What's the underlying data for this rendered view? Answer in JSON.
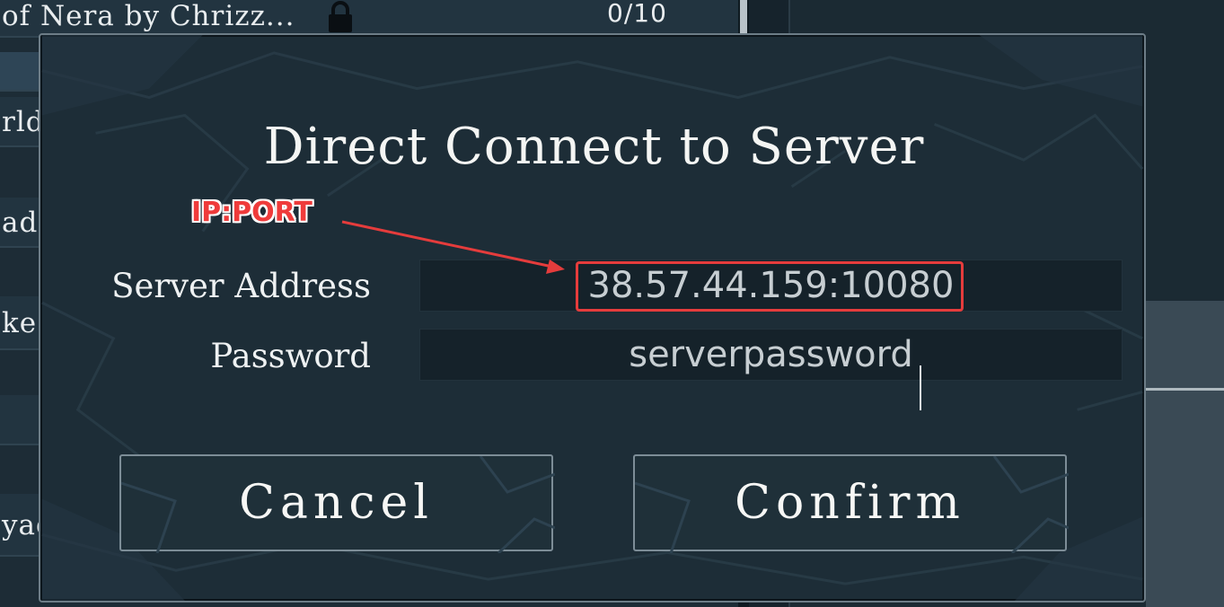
{
  "background": {
    "rows": [
      {
        "text": "of Nera by Chrizz...",
        "count": "0/10"
      },
      {
        "text": ""
      },
      {
        "text": "rld"
      },
      {
        "text": "ad"
      },
      {
        "text": "ke T"
      },
      {
        "text": ""
      },
      {
        "text": "yag"
      }
    ]
  },
  "dialog": {
    "title": "Direct Connect to Server",
    "fields": {
      "address_label": "Server Address",
      "address_value": "38.57.44.159:10080",
      "password_label": "Password",
      "password_value": "serverpassword"
    },
    "buttons": {
      "cancel": "Cancel",
      "confirm": "Confirm"
    }
  },
  "annotation": {
    "label": "IP:PORT",
    "color": "#e53c3c"
  },
  "colors": {
    "panel": "#1d2d37",
    "field": "#15222a",
    "border": "#6d7d87"
  }
}
